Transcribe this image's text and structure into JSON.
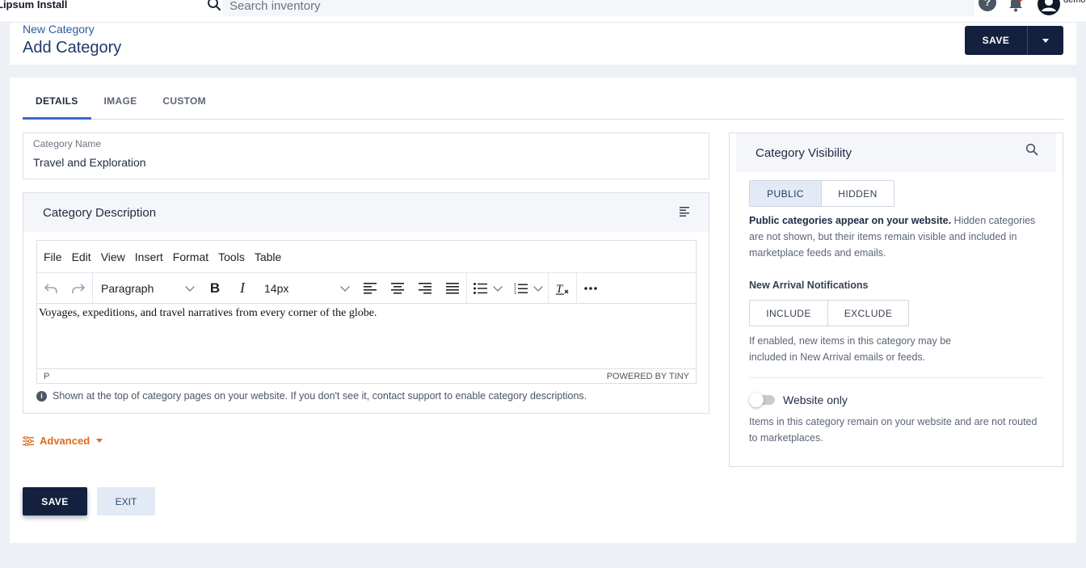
{
  "topbar": {
    "app_name": "Lipsum Install",
    "search_placeholder": "Search inventory",
    "help_glyph": "?",
    "user_name": "demo"
  },
  "header": {
    "breadcrumb": "New Category",
    "title": "Add Category",
    "save_label": "SAVE"
  },
  "tabs": [
    {
      "label": "DETAILS",
      "active": true
    },
    {
      "label": "IMAGE",
      "active": false
    },
    {
      "label": "CUSTOM",
      "active": false
    }
  ],
  "category_name": {
    "label": "Category Name",
    "value": "Travel and Exploration"
  },
  "description": {
    "title": "Category Description",
    "menubar": [
      "File",
      "Edit",
      "View",
      "Insert",
      "Format",
      "Tools",
      "Table"
    ],
    "block_format": "Paragraph",
    "font_size": "14px",
    "content": "Voyages, expeditions, and travel narratives from every corner of the globe.",
    "status_path": "P",
    "powered_by": "POWERED BY TINY",
    "hint": "Shown at the top of category pages on your website. If you don't see it, contact support to enable category descriptions."
  },
  "advanced_label": "Advanced",
  "actions": {
    "save_label": "SAVE",
    "exit_label": "EXIT"
  },
  "visibility": {
    "title": "Category Visibility",
    "options": [
      "PUBLIC",
      "HIDDEN"
    ],
    "selected": "PUBLIC",
    "desc_bold": "Public categories appear on your website.",
    "desc_rest": " Hidden categories are not shown, but their items remain visible and included in marketplace feeds and emails.",
    "new_arrival_title": "New Arrival Notifications",
    "new_arrival_options": [
      "INCLUDE",
      "EXCLUDE"
    ],
    "new_arrival_desc": "If enabled, new items in this category may be included in New Arrival emails or feeds.",
    "website_only_label": "Website only",
    "website_only_on": false,
    "website_only_desc": "Items in this category remain on your website and are not routed to marketplaces."
  },
  "colors": {
    "primary": "#13213f",
    "accent_tab": "#3c6cc8",
    "advanced": "#e06a1b",
    "page_bg": "#edf0f5"
  }
}
